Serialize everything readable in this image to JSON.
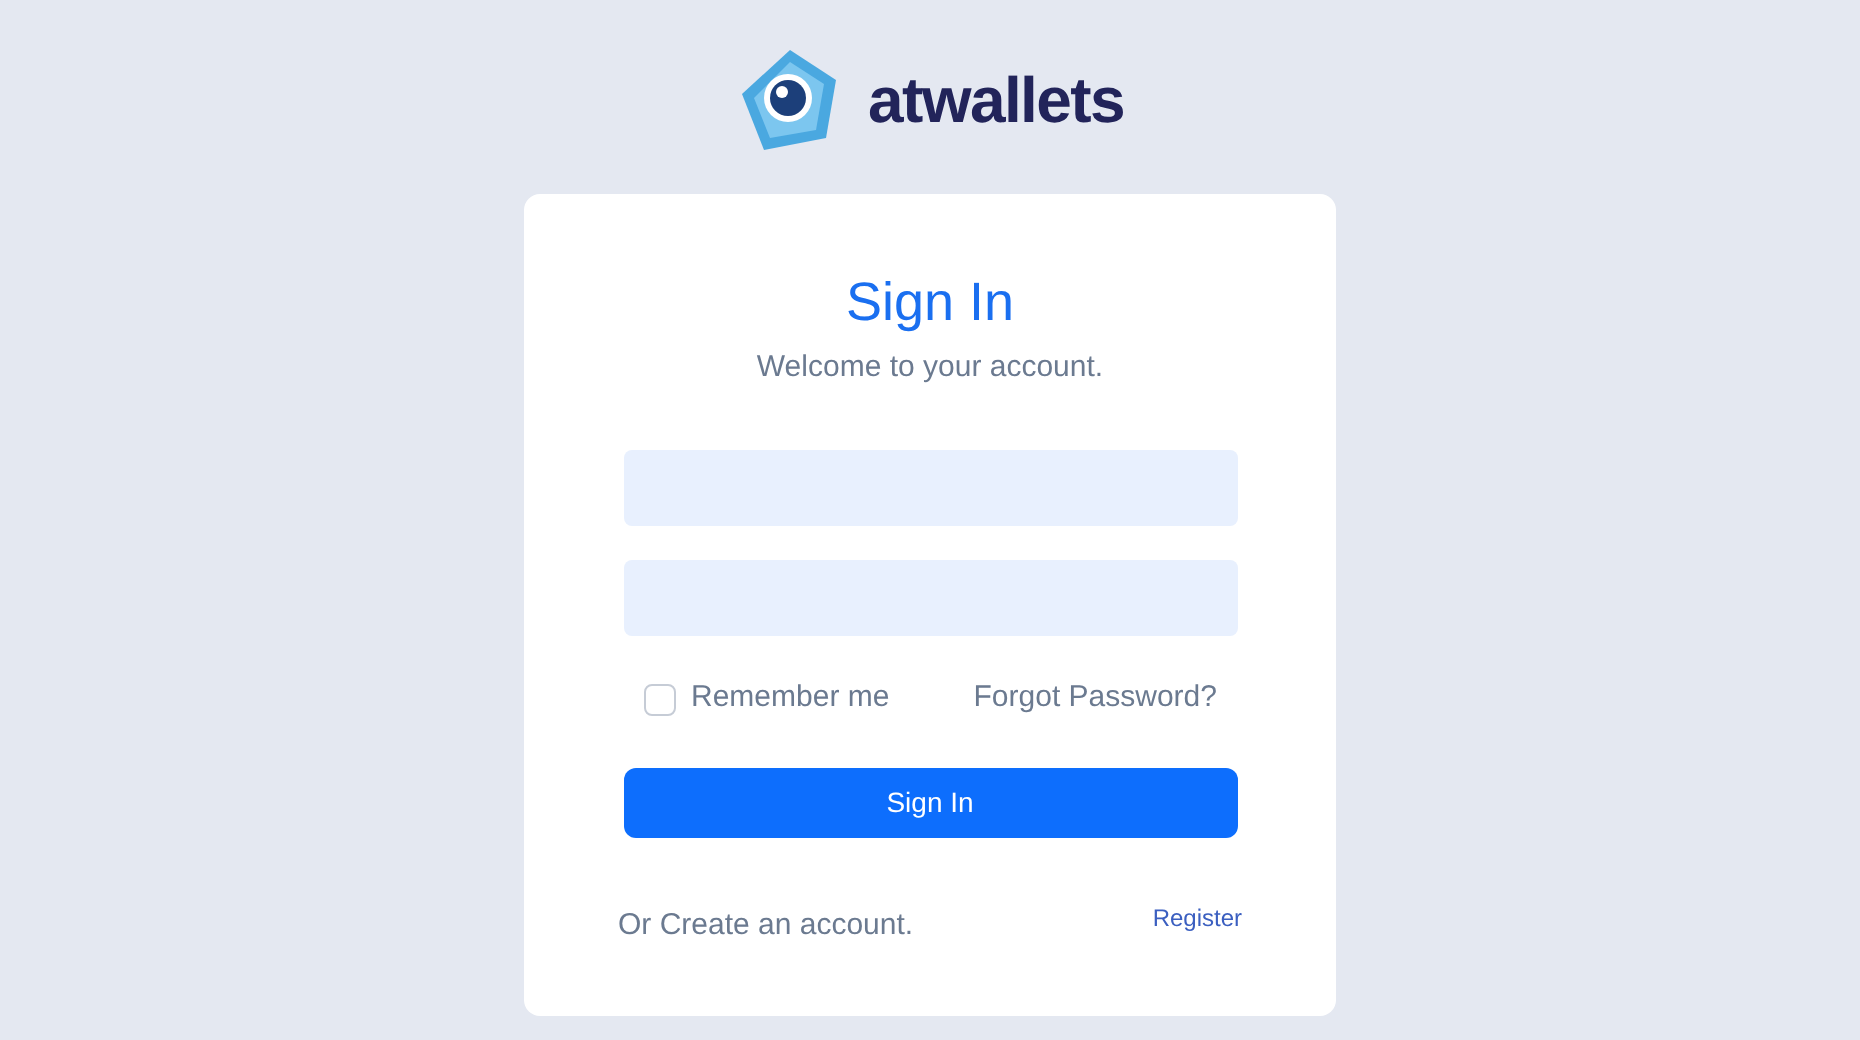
{
  "brand": {
    "name": "atwallets"
  },
  "title": "Sign In",
  "subtitle": "Welcome to your account.",
  "remember": {
    "label": "Remember me",
    "checked": false
  },
  "forgot_link": "Forgot Password?",
  "submit_button": "Sign In",
  "footer": {
    "text": "Or Create an account.",
    "link": "Register"
  }
}
